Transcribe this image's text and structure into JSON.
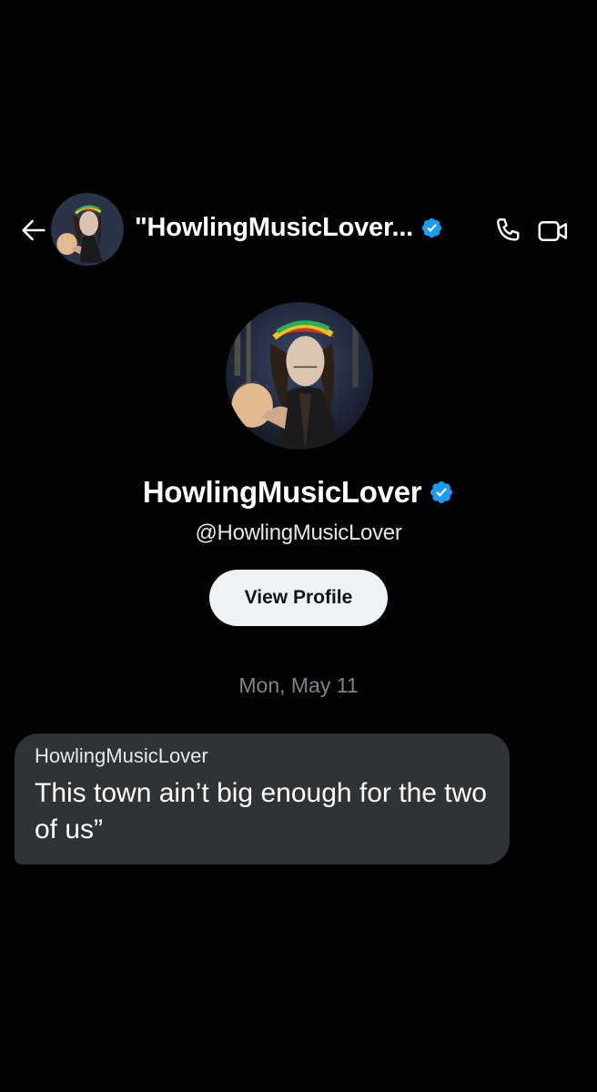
{
  "header": {
    "title": "\"HowlingMusicLover...",
    "back_icon": "arrow-left-icon",
    "call_icon": "phone-icon",
    "video_icon": "video-camera-icon"
  },
  "profile": {
    "display_name": "HowlingMusicLover",
    "handle": "@HowlingMusicLover",
    "view_profile_label": "View Profile",
    "verified": true
  },
  "conversation": {
    "date_separator": "Mon, May 11",
    "messages": [
      {
        "sender": "HowlingMusicLover",
        "text": "This town ain’t big enough for the two of us”"
      }
    ]
  },
  "colors": {
    "background": "#020202",
    "verified_blue": "#1d9bf0",
    "bubble": "#2f3336",
    "button_bg": "#eff2f5",
    "muted_text": "#7e8389"
  }
}
